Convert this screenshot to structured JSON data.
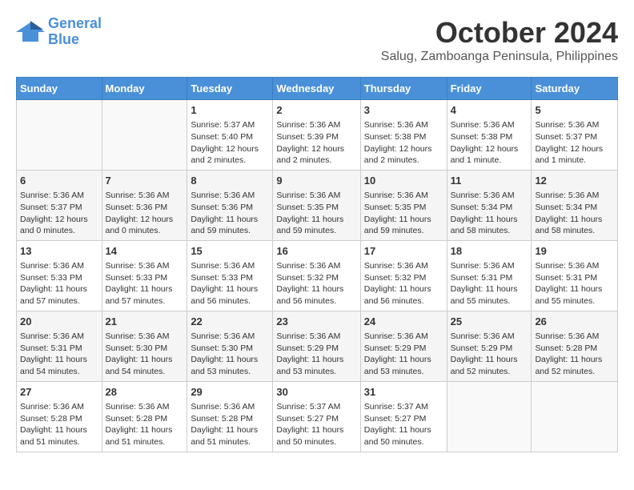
{
  "header": {
    "logo_line1": "General",
    "logo_line2": "Blue",
    "month": "October 2024",
    "location": "Salug, Zamboanga Peninsula, Philippines"
  },
  "weekdays": [
    "Sunday",
    "Monday",
    "Tuesday",
    "Wednesday",
    "Thursday",
    "Friday",
    "Saturday"
  ],
  "weeks": [
    [
      {
        "day": "",
        "info": ""
      },
      {
        "day": "",
        "info": ""
      },
      {
        "day": "1",
        "info": "Sunrise: 5:37 AM\nSunset: 5:40 PM\nDaylight: 12 hours and 2 minutes."
      },
      {
        "day": "2",
        "info": "Sunrise: 5:36 AM\nSunset: 5:39 PM\nDaylight: 12 hours and 2 minutes."
      },
      {
        "day": "3",
        "info": "Sunrise: 5:36 AM\nSunset: 5:38 PM\nDaylight: 12 hours and 2 minutes."
      },
      {
        "day": "4",
        "info": "Sunrise: 5:36 AM\nSunset: 5:38 PM\nDaylight: 12 hours and 1 minute."
      },
      {
        "day": "5",
        "info": "Sunrise: 5:36 AM\nSunset: 5:37 PM\nDaylight: 12 hours and 1 minute."
      }
    ],
    [
      {
        "day": "6",
        "info": "Sunrise: 5:36 AM\nSunset: 5:37 PM\nDaylight: 12 hours and 0 minutes."
      },
      {
        "day": "7",
        "info": "Sunrise: 5:36 AM\nSunset: 5:36 PM\nDaylight: 12 hours and 0 minutes."
      },
      {
        "day": "8",
        "info": "Sunrise: 5:36 AM\nSunset: 5:36 PM\nDaylight: 11 hours and 59 minutes."
      },
      {
        "day": "9",
        "info": "Sunrise: 5:36 AM\nSunset: 5:35 PM\nDaylight: 11 hours and 59 minutes."
      },
      {
        "day": "10",
        "info": "Sunrise: 5:36 AM\nSunset: 5:35 PM\nDaylight: 11 hours and 59 minutes."
      },
      {
        "day": "11",
        "info": "Sunrise: 5:36 AM\nSunset: 5:34 PM\nDaylight: 11 hours and 58 minutes."
      },
      {
        "day": "12",
        "info": "Sunrise: 5:36 AM\nSunset: 5:34 PM\nDaylight: 11 hours and 58 minutes."
      }
    ],
    [
      {
        "day": "13",
        "info": "Sunrise: 5:36 AM\nSunset: 5:33 PM\nDaylight: 11 hours and 57 minutes."
      },
      {
        "day": "14",
        "info": "Sunrise: 5:36 AM\nSunset: 5:33 PM\nDaylight: 11 hours and 57 minutes."
      },
      {
        "day": "15",
        "info": "Sunrise: 5:36 AM\nSunset: 5:33 PM\nDaylight: 11 hours and 56 minutes."
      },
      {
        "day": "16",
        "info": "Sunrise: 5:36 AM\nSunset: 5:32 PM\nDaylight: 11 hours and 56 minutes."
      },
      {
        "day": "17",
        "info": "Sunrise: 5:36 AM\nSunset: 5:32 PM\nDaylight: 11 hours and 56 minutes."
      },
      {
        "day": "18",
        "info": "Sunrise: 5:36 AM\nSunset: 5:31 PM\nDaylight: 11 hours and 55 minutes."
      },
      {
        "day": "19",
        "info": "Sunrise: 5:36 AM\nSunset: 5:31 PM\nDaylight: 11 hours and 55 minutes."
      }
    ],
    [
      {
        "day": "20",
        "info": "Sunrise: 5:36 AM\nSunset: 5:31 PM\nDaylight: 11 hours and 54 minutes."
      },
      {
        "day": "21",
        "info": "Sunrise: 5:36 AM\nSunset: 5:30 PM\nDaylight: 11 hours and 54 minutes."
      },
      {
        "day": "22",
        "info": "Sunrise: 5:36 AM\nSunset: 5:30 PM\nDaylight: 11 hours and 53 minutes."
      },
      {
        "day": "23",
        "info": "Sunrise: 5:36 AM\nSunset: 5:29 PM\nDaylight: 11 hours and 53 minutes."
      },
      {
        "day": "24",
        "info": "Sunrise: 5:36 AM\nSunset: 5:29 PM\nDaylight: 11 hours and 53 minutes."
      },
      {
        "day": "25",
        "info": "Sunrise: 5:36 AM\nSunset: 5:29 PM\nDaylight: 11 hours and 52 minutes."
      },
      {
        "day": "26",
        "info": "Sunrise: 5:36 AM\nSunset: 5:28 PM\nDaylight: 11 hours and 52 minutes."
      }
    ],
    [
      {
        "day": "27",
        "info": "Sunrise: 5:36 AM\nSunset: 5:28 PM\nDaylight: 11 hours and 51 minutes."
      },
      {
        "day": "28",
        "info": "Sunrise: 5:36 AM\nSunset: 5:28 PM\nDaylight: 11 hours and 51 minutes."
      },
      {
        "day": "29",
        "info": "Sunrise: 5:36 AM\nSunset: 5:28 PM\nDaylight: 11 hours and 51 minutes."
      },
      {
        "day": "30",
        "info": "Sunrise: 5:37 AM\nSunset: 5:27 PM\nDaylight: 11 hours and 50 minutes."
      },
      {
        "day": "31",
        "info": "Sunrise: 5:37 AM\nSunset: 5:27 PM\nDaylight: 11 hours and 50 minutes."
      },
      {
        "day": "",
        "info": ""
      },
      {
        "day": "",
        "info": ""
      }
    ]
  ]
}
